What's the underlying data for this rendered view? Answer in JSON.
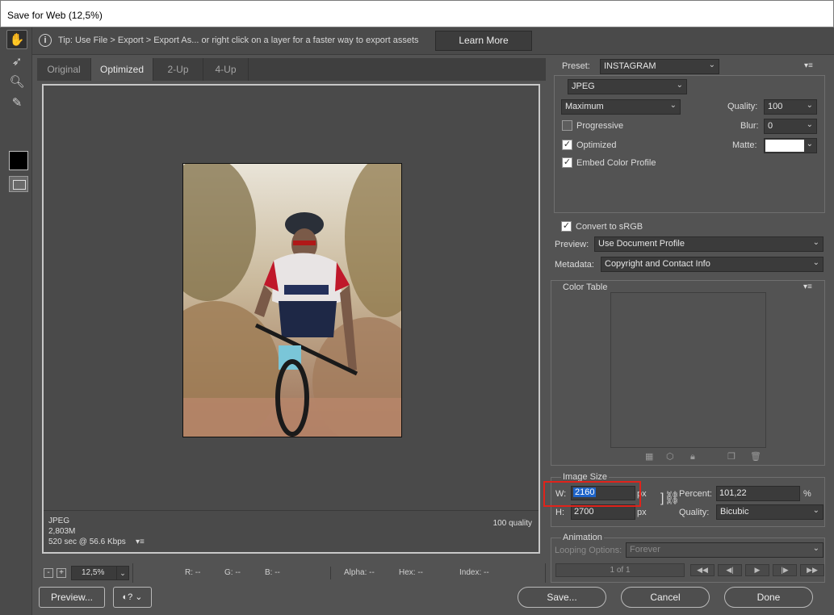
{
  "window": {
    "title": "Save for Web (12,5%)"
  },
  "tip": {
    "icon": "info-icon",
    "text": "Tip: Use File > Export > Export As...  or right click on a layer for a faster way to export assets",
    "learn_more": "Learn More"
  },
  "tabs": [
    "Original",
    "Optimized",
    "2-Up",
    "4-Up"
  ],
  "active_tab": "Optimized",
  "canvas_info": {
    "format": "JPEG",
    "size": "2,803M",
    "time": "520 sec @ 56.6 Kbps",
    "quality": "100 quality"
  },
  "zoom": {
    "value": "12,5%",
    "minus": "-",
    "plus": "+"
  },
  "readouts": {
    "r": "R: --",
    "g": "G: --",
    "b": "B: --",
    "alpha": "Alpha: --",
    "hex": "Hex: --",
    "index": "Index: --"
  },
  "buttons": {
    "preview": "Preview...",
    "save": "Save...",
    "cancel": "Cancel",
    "done": "Done"
  },
  "settings": {
    "preset_label": "Preset:",
    "preset": "INSTAGRAM",
    "format": "JPEG",
    "quality_preset": "Maximum",
    "quality_label": "Quality:",
    "quality": "100",
    "blur_label": "Blur:",
    "blur": "0",
    "matte_label": "Matte:",
    "matte_color": "#ffffff",
    "progressive": "Progressive",
    "progressive_checked": false,
    "optimized": "Optimized",
    "optimized_checked": true,
    "embed": "Embed Color Profile",
    "embed_checked": true,
    "convert": "Convert to sRGB",
    "convert_checked": true,
    "preview_label": "Preview:",
    "preview_value": "Use Document Profile",
    "metadata_label": "Metadata:",
    "metadata_value": "Copyright and Contact Info"
  },
  "color_table": {
    "title": "Color Table"
  },
  "image_size": {
    "title": "Image Size",
    "w_label": "W:",
    "w": "2160",
    "h_label": "H:",
    "h": "2700",
    "unit": "px",
    "percent_label": "Percent:",
    "percent": "101,22",
    "percent_unit": "%",
    "quality_label": "Quality:",
    "quality": "Bicubic"
  },
  "animation": {
    "title": "Animation",
    "looping_label": "Looping Options:",
    "looping": "Forever",
    "frame": "1 of 1"
  },
  "colors": {
    "highlight": "#e0231b",
    "selection": "#1e64c8"
  }
}
